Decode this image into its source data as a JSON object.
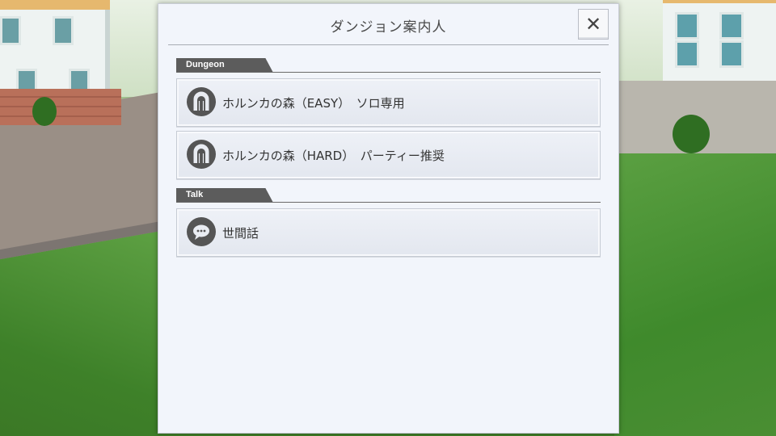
{
  "dialog": {
    "title": "ダンジョン案内人",
    "close_icon": "close-icon"
  },
  "sections": [
    {
      "label": "Dungeon",
      "items": [
        {
          "label": "ホルンカの森（EASY）　ソロ専用",
          "icon": "dungeon-gate-icon"
        },
        {
          "label": "ホルンカの森（HARD）　パーティー推奨",
          "icon": "dungeon-gate-icon"
        }
      ]
    },
    {
      "label": "Talk",
      "items": [
        {
          "label": "世間話",
          "icon": "speech-bubble-icon"
        }
      ]
    }
  ],
  "colors": {
    "dialog_bg": "#f2f5fb",
    "section_tab": "#5c5c5c",
    "icon_bg": "#555555"
  }
}
